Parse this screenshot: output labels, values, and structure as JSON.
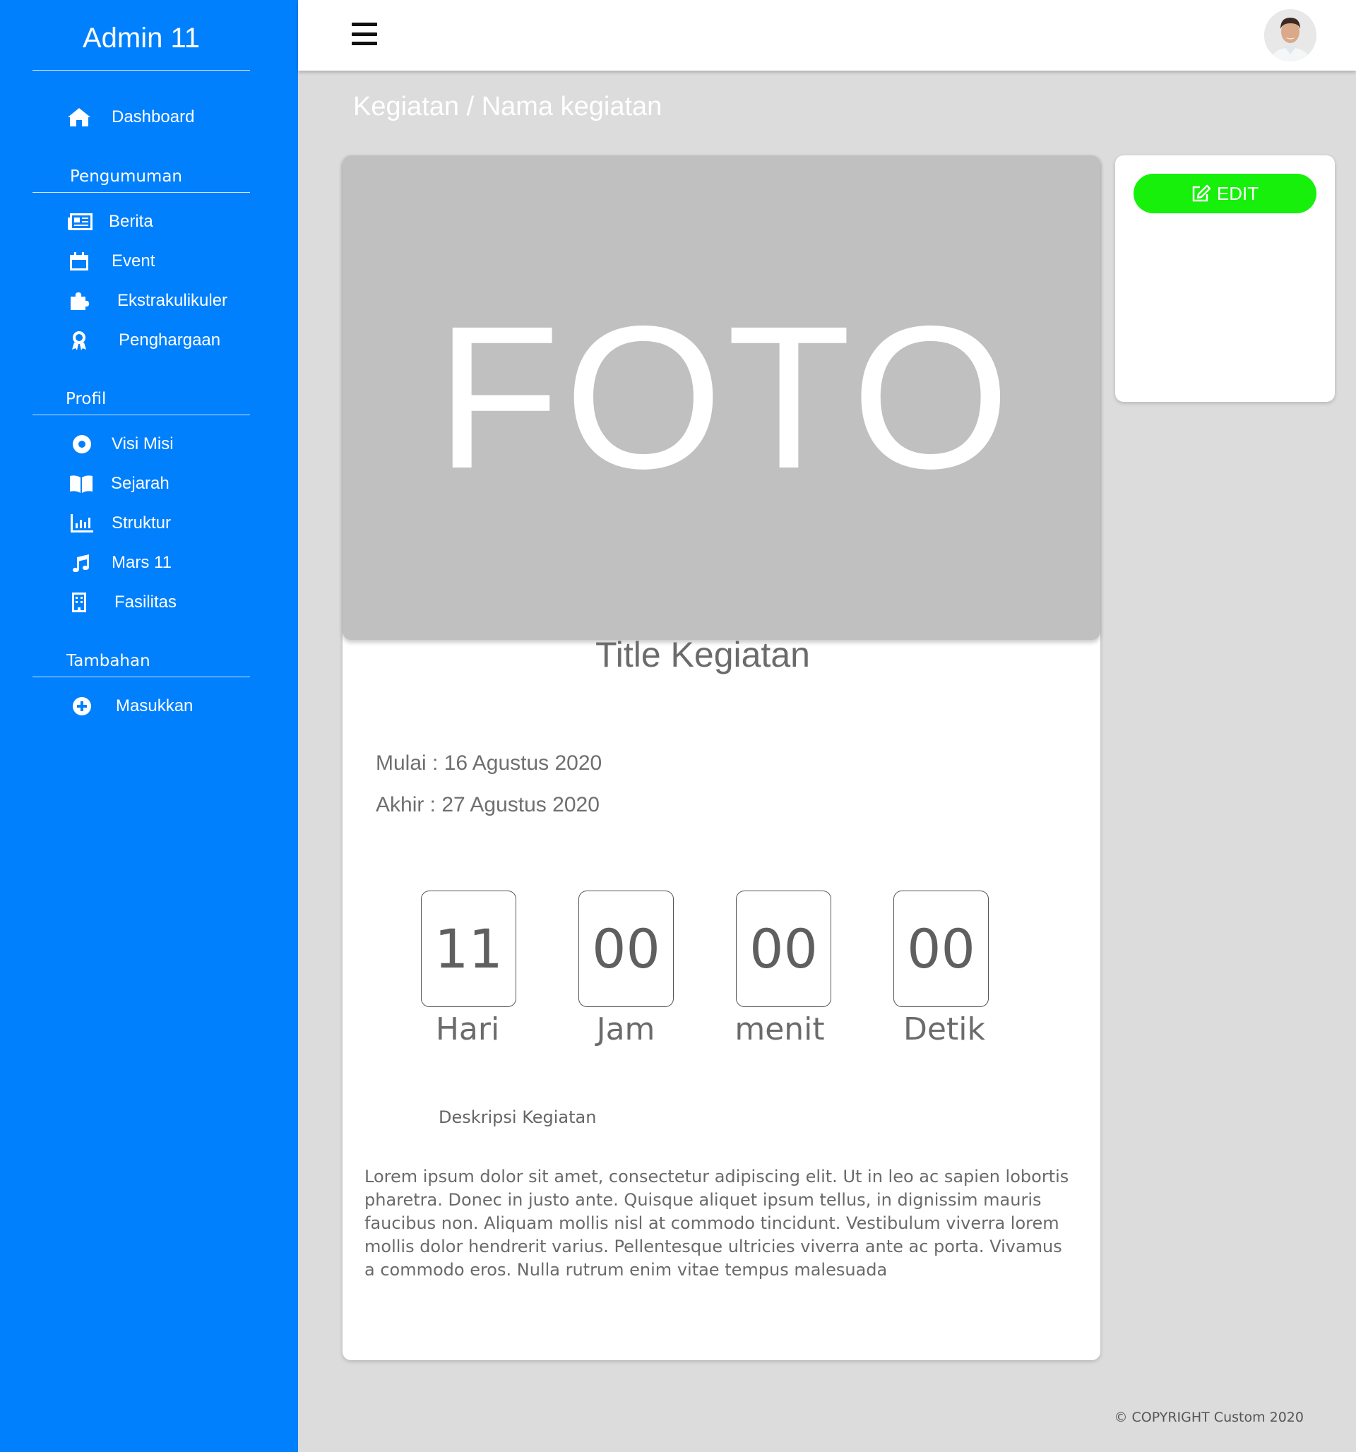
{
  "sidebar": {
    "brand": "Admin 11",
    "dashboard": {
      "label": "Dashboard",
      "icon": "home-icon"
    },
    "sections": [
      {
        "title": "Pengumuman",
        "items": [
          {
            "label": "Berita",
            "icon": "newspaper-icon"
          },
          {
            "label": "Event",
            "icon": "calendar-icon"
          },
          {
            "label": "Ekstrakulikuler",
            "icon": "puzzle-icon"
          },
          {
            "label": "Penghargaan",
            "icon": "award-icon"
          }
        ]
      },
      {
        "title": "Profil",
        "items": [
          {
            "label": "Visi Misi",
            "icon": "dot-circle-icon"
          },
          {
            "label": "Sejarah",
            "icon": "book-icon"
          },
          {
            "label": "Struktur",
            "icon": "bar-chart-icon"
          },
          {
            "label": "Mars 11",
            "icon": "music-icon"
          },
          {
            "label": "Fasilitas",
            "icon": "building-icon"
          }
        ]
      },
      {
        "title": "Tambahan",
        "items": [
          {
            "label": "Masukkan",
            "icon": "plus-circle-icon"
          }
        ]
      }
    ]
  },
  "topbar": {
    "menu_icon": "hamburger-icon",
    "avatar": "user-avatar"
  },
  "breadcrumb": "Kegiatan / Nama kegiatan",
  "activity": {
    "photo_placeholder": "FOTO",
    "title": "Title Kegiatan",
    "start": "Mulai : 16 Agustus 2020",
    "end": "Akhir : 27 Agustus 2020",
    "countdown": [
      {
        "value": "11",
        "label": "Hari"
      },
      {
        "value": "00",
        "label": "Jam"
      },
      {
        "value": "00",
        "label": "menit"
      },
      {
        "value": "00",
        "label": "Detik"
      }
    ],
    "description_title": "Deskripsi Kegiatan",
    "description": "Lorem ipsum dolor sit amet, consectetur adipiscing elit. Ut in leo ac sapien lobortis pharetra. Donec in justo ante. Quisque aliquet ipsum tellus, in dignissim mauris faucibus non. Aliquam mollis nisl at commodo tincidunt. Vestibulum viverra lorem mollis dolor hendrerit varius. Pellentesque ultricies viverra ante ac porta. Vivamus a commodo eros. Nulla rutrum enim vitae tempus malesuada"
  },
  "actions": {
    "edit_label": "EDIT",
    "edit_color": "#16f00b"
  },
  "footer": "© COPYRIGHT Custom 2020",
  "colors": {
    "sidebar": "#0080fd",
    "background": "#dcdcdc"
  }
}
